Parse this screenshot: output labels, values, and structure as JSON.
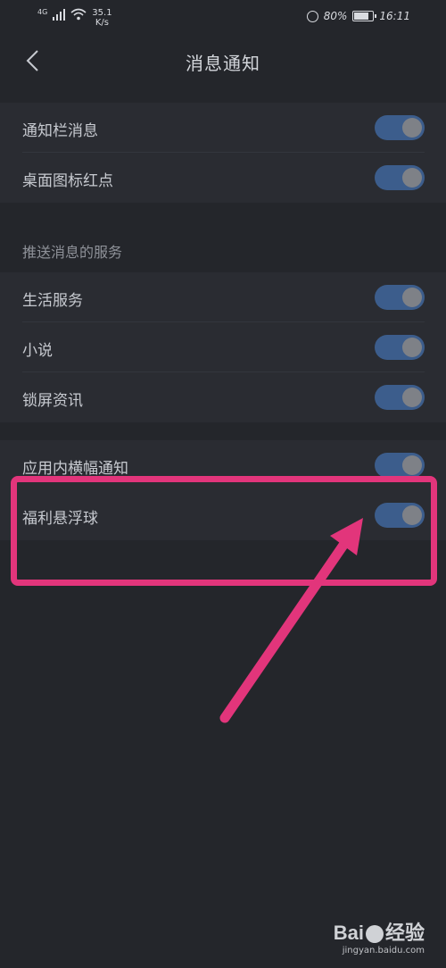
{
  "status_bar": {
    "network": "4G",
    "speed_value": "35.1",
    "speed_unit": "K/s",
    "battery": "80%",
    "battery_level": 0.8,
    "time": "16:11"
  },
  "header": {
    "title": "消息通知",
    "back_icon": "chevron-left-icon"
  },
  "groups": [
    {
      "items": [
        {
          "label": "通知栏消息",
          "enabled": true
        },
        {
          "label": "桌面图标红点",
          "enabled": true
        }
      ]
    },
    {
      "section_title": "推送消息的服务",
      "items": [
        {
          "label": "生活服务",
          "enabled": true
        },
        {
          "label": "小说",
          "enabled": true
        },
        {
          "label": "锁屏资讯",
          "enabled": true
        }
      ]
    },
    {
      "items": [
        {
          "label": "应用内横幅通知",
          "enabled": true
        },
        {
          "label": "福利悬浮球",
          "enabled": true
        }
      ]
    }
  ],
  "colors": {
    "background": "#24262b",
    "switch_on": "#3c5d8c",
    "highlight": "#e2357b"
  },
  "watermark": {
    "brand_part1": "Bai",
    "brand_part2": "经验",
    "url": "jingyan.baidu.com"
  }
}
